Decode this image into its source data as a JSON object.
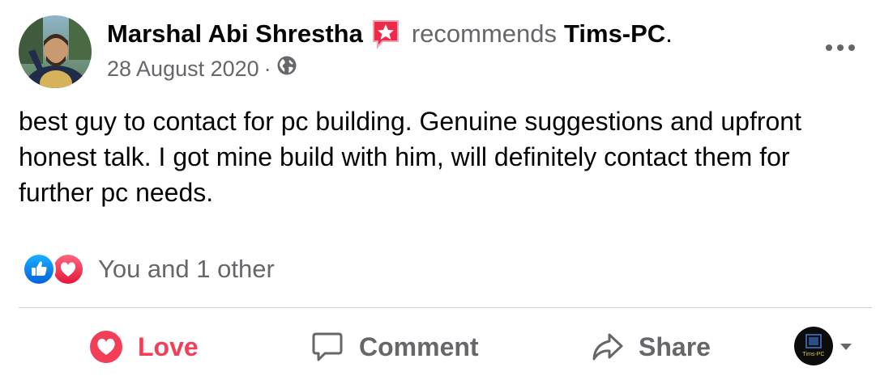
{
  "post": {
    "author": "Marshal Abi Shrestha",
    "verb": "recommends",
    "page_name": "Tims-PC",
    "period": ".",
    "date": "28 August 2020",
    "separator": "·",
    "privacy_icon": "globe-icon",
    "recommend_icon": "recommendation-star-icon",
    "text": "best guy to contact for pc building. Genuine suggestions and upfront honest talk. I got mine build with him, will definitely contact them for further pc needs."
  },
  "reactions": {
    "icons": [
      "like-icon",
      "love-icon"
    ],
    "summary": "You and 1 other"
  },
  "actions": {
    "love_label": "Love",
    "comment_label": "Comment",
    "share_label": "Share"
  },
  "page_avatar": {
    "logo_text": "Tims-PC"
  },
  "colors": {
    "love_red": "#f33e58",
    "like_blue": "#1877f2",
    "muted_gray": "#65676b",
    "recommend_pink": "#f02849"
  }
}
